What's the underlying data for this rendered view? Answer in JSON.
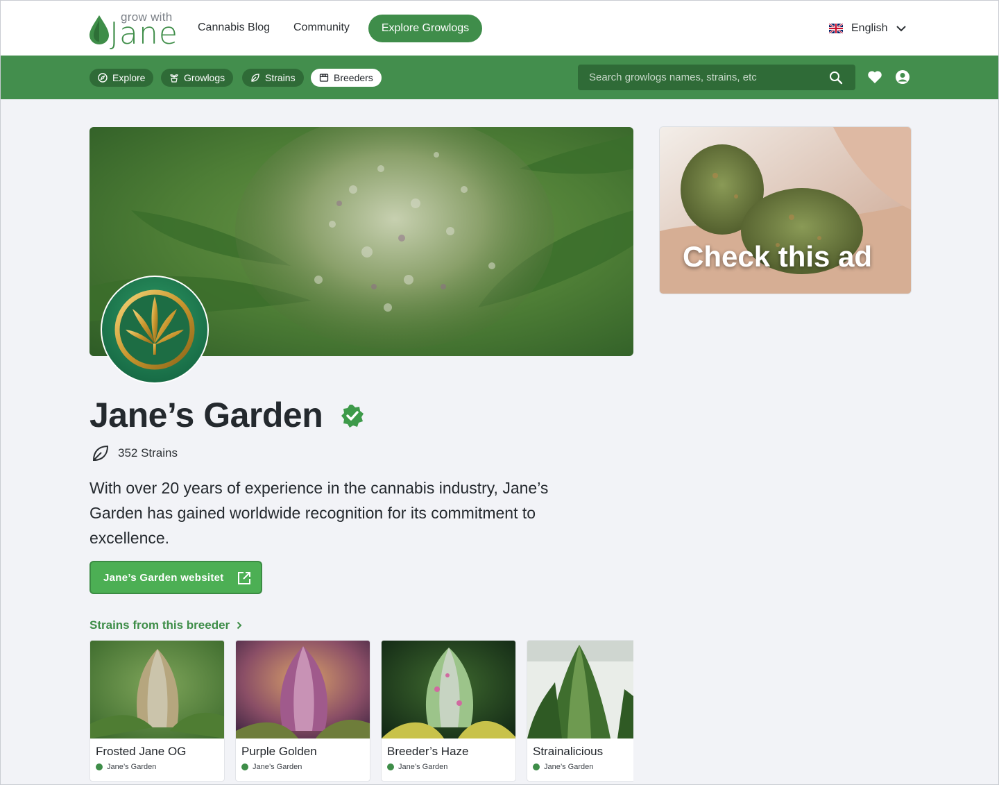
{
  "brand": {
    "logo_small": "grow with",
    "logo_big": "Jane"
  },
  "header": {
    "nav": [
      "Cannabis Blog",
      "Community"
    ],
    "cta": "Explore Growlogs",
    "language": "English"
  },
  "subnav": {
    "tabs": [
      {
        "label": "Explore",
        "icon": "compass-icon"
      },
      {
        "label": "Growlogs",
        "icon": "plant-pot-icon"
      },
      {
        "label": "Strains",
        "icon": "leaf-icon"
      },
      {
        "label": "Breeders",
        "icon": "store-icon",
        "active": true
      }
    ],
    "search_placeholder": "Search growlogs names, strains, etc"
  },
  "breeder": {
    "name": "Jane’s Garden",
    "strains_count": "352 Strains",
    "description": "With over 20 years of experience in the cannabis industry, Jane’s Garden has gained worldwide recognition for its commitment to excellence.",
    "website_label": "Jane’s Garden websitet"
  },
  "strains_section": {
    "title": "Strains from this breeder",
    "items": [
      {
        "name": "Frosted Jane OG",
        "breeder": "Jane’s Garden"
      },
      {
        "name": "Purple Golden",
        "breeder": "Jane’s Garden"
      },
      {
        "name": "Breeder’s Haze",
        "breeder": "Jane’s Garden"
      },
      {
        "name": "Strainalicious",
        "breeder": "Jane’s Garden"
      }
    ]
  },
  "ad": {
    "text": "Check this ad"
  },
  "colors": {
    "brand_green": "#3e8d48",
    "subnav_green": "#438e4d",
    "pill_dark": "#2f6b37",
    "button_green": "#4caf54"
  }
}
